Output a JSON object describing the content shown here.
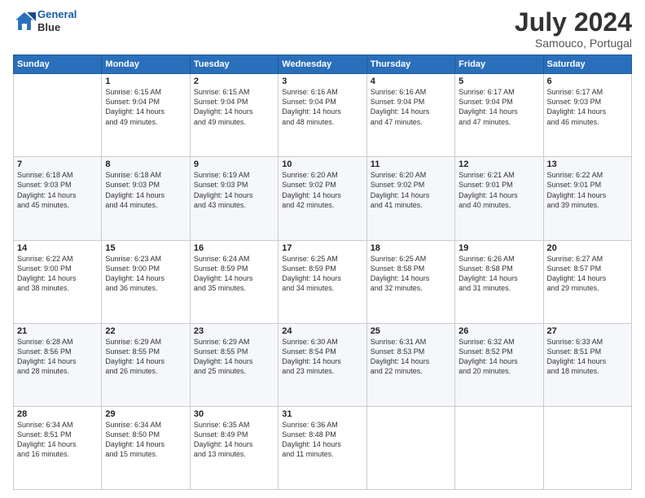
{
  "logo": {
    "line1": "General",
    "line2": "Blue"
  },
  "title": "July 2024",
  "location": "Samouco, Portugal",
  "days_header": [
    "Sunday",
    "Monday",
    "Tuesday",
    "Wednesday",
    "Thursday",
    "Friday",
    "Saturday"
  ],
  "weeks": [
    [
      {
        "day": "",
        "text": ""
      },
      {
        "day": "1",
        "text": "Sunrise: 6:15 AM\nSunset: 9:04 PM\nDaylight: 14 hours\nand 49 minutes."
      },
      {
        "day": "2",
        "text": "Sunrise: 6:15 AM\nSunset: 9:04 PM\nDaylight: 14 hours\nand 49 minutes."
      },
      {
        "day": "3",
        "text": "Sunrise: 6:16 AM\nSunset: 9:04 PM\nDaylight: 14 hours\nand 48 minutes."
      },
      {
        "day": "4",
        "text": "Sunrise: 6:16 AM\nSunset: 9:04 PM\nDaylight: 14 hours\nand 47 minutes."
      },
      {
        "day": "5",
        "text": "Sunrise: 6:17 AM\nSunset: 9:04 PM\nDaylight: 14 hours\nand 47 minutes."
      },
      {
        "day": "6",
        "text": "Sunrise: 6:17 AM\nSunset: 9:03 PM\nDaylight: 14 hours\nand 46 minutes."
      }
    ],
    [
      {
        "day": "7",
        "text": "Sunrise: 6:18 AM\nSunset: 9:03 PM\nDaylight: 14 hours\nand 45 minutes."
      },
      {
        "day": "8",
        "text": "Sunrise: 6:18 AM\nSunset: 9:03 PM\nDaylight: 14 hours\nand 44 minutes."
      },
      {
        "day": "9",
        "text": "Sunrise: 6:19 AM\nSunset: 9:03 PM\nDaylight: 14 hours\nand 43 minutes."
      },
      {
        "day": "10",
        "text": "Sunrise: 6:20 AM\nSunset: 9:02 PM\nDaylight: 14 hours\nand 42 minutes."
      },
      {
        "day": "11",
        "text": "Sunrise: 6:20 AM\nSunset: 9:02 PM\nDaylight: 14 hours\nand 41 minutes."
      },
      {
        "day": "12",
        "text": "Sunrise: 6:21 AM\nSunset: 9:01 PM\nDaylight: 14 hours\nand 40 minutes."
      },
      {
        "day": "13",
        "text": "Sunrise: 6:22 AM\nSunset: 9:01 PM\nDaylight: 14 hours\nand 39 minutes."
      }
    ],
    [
      {
        "day": "14",
        "text": "Sunrise: 6:22 AM\nSunset: 9:00 PM\nDaylight: 14 hours\nand 38 minutes."
      },
      {
        "day": "15",
        "text": "Sunrise: 6:23 AM\nSunset: 9:00 PM\nDaylight: 14 hours\nand 36 minutes."
      },
      {
        "day": "16",
        "text": "Sunrise: 6:24 AM\nSunset: 8:59 PM\nDaylight: 14 hours\nand 35 minutes."
      },
      {
        "day": "17",
        "text": "Sunrise: 6:25 AM\nSunset: 8:59 PM\nDaylight: 14 hours\nand 34 minutes."
      },
      {
        "day": "18",
        "text": "Sunrise: 6:25 AM\nSunset: 8:58 PM\nDaylight: 14 hours\nand 32 minutes."
      },
      {
        "day": "19",
        "text": "Sunrise: 6:26 AM\nSunset: 8:58 PM\nDaylight: 14 hours\nand 31 minutes."
      },
      {
        "day": "20",
        "text": "Sunrise: 6:27 AM\nSunset: 8:57 PM\nDaylight: 14 hours\nand 29 minutes."
      }
    ],
    [
      {
        "day": "21",
        "text": "Sunrise: 6:28 AM\nSunset: 8:56 PM\nDaylight: 14 hours\nand 28 minutes."
      },
      {
        "day": "22",
        "text": "Sunrise: 6:29 AM\nSunset: 8:55 PM\nDaylight: 14 hours\nand 26 minutes."
      },
      {
        "day": "23",
        "text": "Sunrise: 6:29 AM\nSunset: 8:55 PM\nDaylight: 14 hours\nand 25 minutes."
      },
      {
        "day": "24",
        "text": "Sunrise: 6:30 AM\nSunset: 8:54 PM\nDaylight: 14 hours\nand 23 minutes."
      },
      {
        "day": "25",
        "text": "Sunrise: 6:31 AM\nSunset: 8:53 PM\nDaylight: 14 hours\nand 22 minutes."
      },
      {
        "day": "26",
        "text": "Sunrise: 6:32 AM\nSunset: 8:52 PM\nDaylight: 14 hours\nand 20 minutes."
      },
      {
        "day": "27",
        "text": "Sunrise: 6:33 AM\nSunset: 8:51 PM\nDaylight: 14 hours\nand 18 minutes."
      }
    ],
    [
      {
        "day": "28",
        "text": "Sunrise: 6:34 AM\nSunset: 8:51 PM\nDaylight: 14 hours\nand 16 minutes."
      },
      {
        "day": "29",
        "text": "Sunrise: 6:34 AM\nSunset: 8:50 PM\nDaylight: 14 hours\nand 15 minutes."
      },
      {
        "day": "30",
        "text": "Sunrise: 6:35 AM\nSunset: 8:49 PM\nDaylight: 14 hours\nand 13 minutes."
      },
      {
        "day": "31",
        "text": "Sunrise: 6:36 AM\nSunset: 8:48 PM\nDaylight: 14 hours\nand 11 minutes."
      },
      {
        "day": "",
        "text": ""
      },
      {
        "day": "",
        "text": ""
      },
      {
        "day": "",
        "text": ""
      }
    ]
  ]
}
